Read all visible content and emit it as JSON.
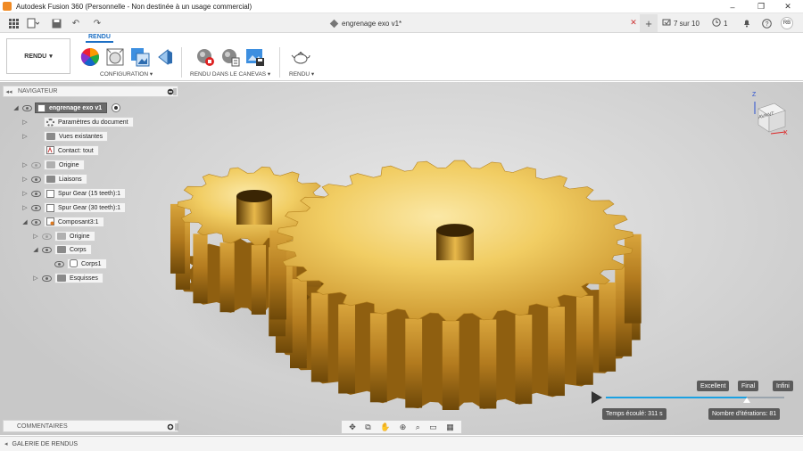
{
  "window": {
    "title": "Autodesk Fusion 360 (Personnelle - Non destinée à un usage commercial)",
    "minimize": "–",
    "restore": "❐",
    "close": "✕"
  },
  "tabbar": {
    "document_title": "engrenage exo v1*",
    "close_tab": "✕",
    "new_tab": "+",
    "jobs": "7 sur 10",
    "online_count": "1",
    "avatar": "RB"
  },
  "ribbon": {
    "workspace": "RENDU",
    "active_tab": "RENDU",
    "groups": {
      "configuration": "CONFIGURATION ▾",
      "canvas_render": "RENDU DANS LE CANEVAS ▾",
      "render": "RENDU ▾"
    }
  },
  "browser": {
    "header": "NAVIGATEUR",
    "root": "engrenage exo v1",
    "items": [
      {
        "label": "Paramètres du document"
      },
      {
        "label": "Vues existantes"
      },
      {
        "label": "Contact: tout"
      },
      {
        "label": "Origine"
      },
      {
        "label": "Liaisons"
      },
      {
        "label": "Spur Gear (15 teeth):1"
      },
      {
        "label": "Spur Gear (30 teeth):1"
      },
      {
        "label": "Composant3:1"
      },
      {
        "label": "Origine"
      },
      {
        "label": "Corps"
      },
      {
        "label": "Corps1"
      },
      {
        "label": "Esquisses"
      }
    ]
  },
  "viewcube": {
    "face": "AVANT",
    "axis_z": "Z",
    "axis_x": "X"
  },
  "render_progress": {
    "quality_labels": [
      "Excellent",
      "Final",
      "Infini"
    ],
    "progress_fraction": 0.79,
    "elapsed": "Temps écoulé: 311 s",
    "iterations": "Nombre d'itérations: 81"
  },
  "comments": {
    "label": "COMMENTAIRES"
  },
  "gallery": {
    "label": "GALERIE DE RENDUS"
  },
  "colors": {
    "accent": "#1c6fc4",
    "progress": "#1ba1e2",
    "gold_light": "#f4cf63",
    "gold_dark": "#8f5f10"
  }
}
